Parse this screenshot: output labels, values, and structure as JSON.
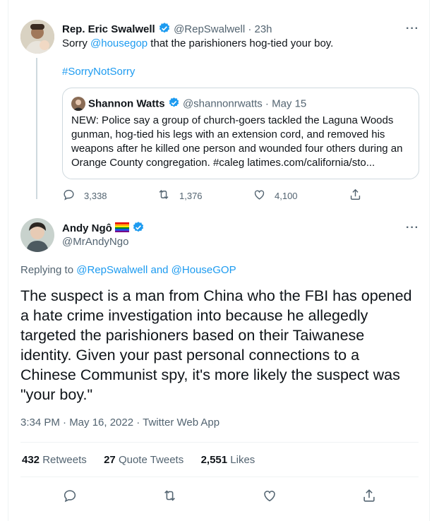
{
  "parent_tweet": {
    "author_name": "Rep. Eric Swalwell",
    "handle_time": "@RepSwalwell · 23h",
    "text_prefix": "Sorry ",
    "mention": "@housegop",
    "text_suffix": " that the parishioners hog-tied your boy.",
    "hashtag": "#SorryNotSorry",
    "quoted": {
      "author_name": "Shannon Watts",
      "handle_date": "@shannonrwatts · May 15",
      "text": "NEW: Police say a group of church-goers tackled the Laguna Woods gunman, hog-tied his legs with an extension cord, and removed his weapons after he killed one person and wounded four others during an Orange County congregation. #caleg  latimes.com/california/sto..."
    },
    "actions": {
      "replies": "3,338",
      "retweets": "1,376",
      "likes": "4,100"
    }
  },
  "main_tweet": {
    "author_name": "Andy Ngô",
    "flag_emoji": "🏳️‍🌈",
    "handle": "@MrAndyNgo",
    "replying_prefix": "Replying to ",
    "replying_users": "@RepSwalwell and @HouseGOP",
    "text": "The suspect is a man from China who the FBI has opened a hate crime investigation into because he allegedly targeted the parishioners based on their Taiwanese identity. Given your past personal connections to a Chinese Communist spy, it's more likely the suspect was \"your boy.\"",
    "timestamp": "3:34 PM · May 16, 2022 · Twitter Web App",
    "stats": {
      "retweets_count": "432",
      "retweets_label": "Retweets",
      "quotes_count": "27",
      "quotes_label": "Quote Tweets",
      "likes_count": "2,551",
      "likes_label": "Likes"
    }
  },
  "icons": {
    "more": "···",
    "verified_color": "#1d9bf0",
    "reply": "reply-icon",
    "retweet": "retweet-icon",
    "like": "like-icon",
    "share": "share-icon"
  }
}
